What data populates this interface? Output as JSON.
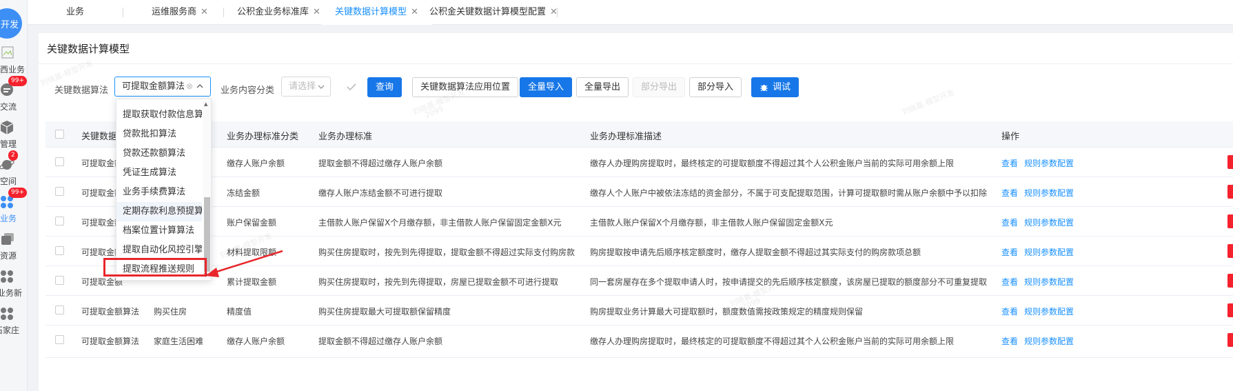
{
  "rail": {
    "logo": "开发",
    "items": [
      {
        "label": "西业务",
        "badge": ""
      },
      {
        "label": "交流",
        "badge": "99+"
      },
      {
        "label": "管理",
        "badge": ""
      },
      {
        "label": "空间",
        "badge": "2"
      },
      {
        "label": "业务",
        "badge": "99+"
      },
      {
        "label": "资源",
        "badge": ""
      },
      {
        "label": "业务新",
        "badge": ""
      },
      {
        "label": "石家庄",
        "badge": ""
      }
    ]
  },
  "tabs": [
    {
      "label": "业务",
      "close": ""
    },
    {
      "label": "运维服务商",
      "close": "✕"
    },
    {
      "label": "公积金业务标准库",
      "close": "✕"
    },
    {
      "label": "关键数据计算模型",
      "close": "✕"
    },
    {
      "label": "公积金关键数据计算模型配置",
      "close": "✕"
    }
  ],
  "page_title": "关键数据计算模型",
  "filters": {
    "algo_label": "关键数据算法",
    "algo_value": "可提取金额算法",
    "category_label": "业务内容分类",
    "category_placeholder": "请选择"
  },
  "buttons": {
    "query": "查询",
    "apply_location": "关键数据算法应用位置",
    "import_all": "全量导入",
    "export_all": "全量导出",
    "export_part": "部分导出",
    "import_part": "部分导入",
    "debug": "调试"
  },
  "dropdown": {
    "options": [
      "提取获取付款信息算",
      "贷款批扣算法",
      "贷款还款额算法",
      "凭证生成算法",
      "业务手续费算法",
      "定期存款利息预提算",
      "档案位置计算算法",
      "提取自动化风控引擎",
      "提取流程推送规则"
    ]
  },
  "table": {
    "headers": [
      "关键数据",
      "业务办理标准分类",
      "业务办理标准",
      "业务办理标准描述",
      "操作"
    ],
    "rows": [
      {
        "algo": "可提取金额",
        "category": "",
        "class": "缴存人账户余额",
        "standard": "提取金额不得超过缴存人账户余额",
        "desc": "缴存人办理购房提取时，最终核定的可提取额度不得超过其个人公积金账户当前的实际可用余额上限"
      },
      {
        "algo": "可提取金额",
        "category": "",
        "class": "冻结金额",
        "standard": "缴存人账户冻结金额不可进行提取",
        "desc": "缴存人个人账户中被依法冻结的资金部分，不属于可支配提取范围，计算可提取额时需从账户余额中予以扣除"
      },
      {
        "algo": "可提取金额",
        "category": "",
        "class": "账户保留金额",
        "standard": "主借款人账户保留X个月缴存额，非主借款人账户保留固定金额X元",
        "desc": "主借款人账户保留X个月缴存额，非主借款人账户保留固定金额X元"
      },
      {
        "algo": "可提取金额",
        "category": "",
        "class": "材料提取限额",
        "standard": "购买住房提取时，按先到先得提取，提取金额不得超过实际支付购房款",
        "desc": "购房提取按申请先后顺序核定额度时，缴存人提取金额不得超过其实际支付的购房款项总额"
      },
      {
        "algo": "可提取金额",
        "category": "",
        "class": "累计提取金额",
        "standard": "购买住房提取时，按先到先得提取，房屋已提取金额不可进行提取",
        "desc": "同一套房屋存在多个提取申请人时，按申请提交的先后顺序核定额度，该房屋已提取的额度部分不可重复提取"
      },
      {
        "algo": "可提取金额算法",
        "category": "购买住房",
        "class": "精度值",
        "standard": "购买住房提取最大可提取额保留精度",
        "desc": "购房提取业务计算最大可提取额时，额度数值需按政策规定的精度规则保留"
      },
      {
        "algo": "可提取金额算法",
        "category": "家庭生活困难",
        "class": "缴存人账户余额",
        "standard": "提取金额不得超过缴存人账户余额",
        "desc": "缴存人办理购房提取时，最终核定的可提取额度不得超过其个人公积金账户当前的实际可用余额上限"
      }
    ],
    "actions": {
      "view": "查看",
      "config": "规则参数配置"
    }
  },
  "watermark": {
    "name": "刘晓晨-模型开发",
    "code": "2099"
  }
}
